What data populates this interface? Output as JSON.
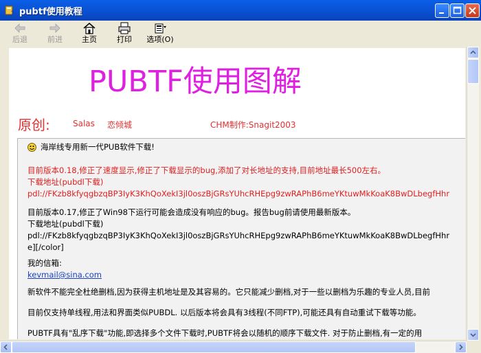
{
  "window": {
    "title": "pubtf使用教程"
  },
  "toolbar": {
    "back_label": "后退",
    "forward_label": "前进",
    "home_label": "主页",
    "print_label": "打印",
    "options_label": "选项(O)"
  },
  "page": {
    "heading": "PUBTF使用图解",
    "origin_label": "原创:",
    "author_1": "Salas",
    "author_2": "恋倾城",
    "chm_credit": "CHM制作:Snagit2003"
  },
  "post": {
    "header": "海岸线专用新一代PUB软件下载!",
    "v018_text": "目前版本0.18,修正了速度显示,修正了下载显示的bug,添加了对长地址的支持,目前地址最长500左右。",
    "v018_dl_label": "下载地址(pubdl下载)",
    "v018_dl_url": "pdl://FKzb8kfyqgbzqBP3IyK3KhQoXekI3jl0oszBjGRsYUhcRHEpg9zwRAPhB6meYKtuwMkKoaK8BwDLbegfHhr",
    "v017_text": "目前版本0.17,修正了Win98下运行可能会造成没有响应的bug。报告bug前请使用最新版本。",
    "v017_dl_label": "下载地址(pubdl下载)",
    "v017_dl_url": "pdl://FKzb8kfyqgbzqBP3IyK3KhQoXekI3jl0oszBjGRsYUhcRHEpg9zwRAPhB6meYKtuwMkKoaK8BwDLbegfHhr",
    "v017_tail": "e][/color]",
    "mail_label": "我的信箱:",
    "mail_address": "kevmail@sina.com",
    "para_1": "新软件不能完全杜绝删档,因为获得主机地址是及其容易的。它只能减少删档,对于一些以删档为乐趣的专业人员,目前",
    "para_2": "目前仅支持单线程,用法和界面类似PUBDL. 以后版本将会具有3线程(不同FTP),可能还具有自动重试下载等功能。",
    "para_3": "PUBTF具有\"乱序下载\"功能,即选择多个文件下载时,PUBTF将会以随机的顺序下载文件. 对于防止删档,有一定的用"
  },
  "colors": {
    "heading": "#E020E0",
    "red_text": "#E02020",
    "link": "#1A3FC4"
  }
}
